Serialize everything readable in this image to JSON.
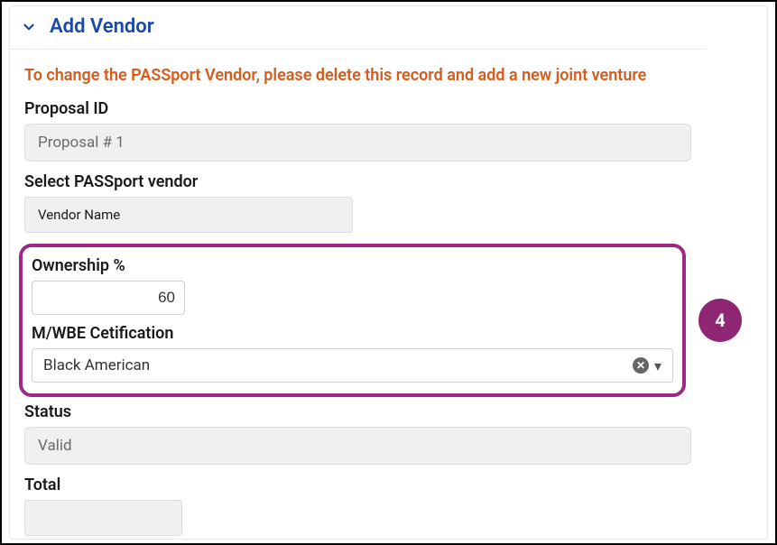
{
  "header": {
    "title": "Add Vendor"
  },
  "warning_text": "To change the PASSport Vendor, please delete this record and add a new joint venture",
  "fields": {
    "proposal_id": {
      "label": "Proposal ID",
      "value": "Proposal # 1"
    },
    "vendor": {
      "label": "Select PASSport vendor",
      "value": "Vendor Name"
    },
    "ownership": {
      "label": "Ownership %",
      "value": "60"
    },
    "cert": {
      "label": "M/WBE Cetification",
      "value": "Black American"
    },
    "status": {
      "label": "Status",
      "value": "Valid"
    },
    "total": {
      "label": "Total",
      "value": ""
    }
  },
  "badge": {
    "number": "4"
  }
}
